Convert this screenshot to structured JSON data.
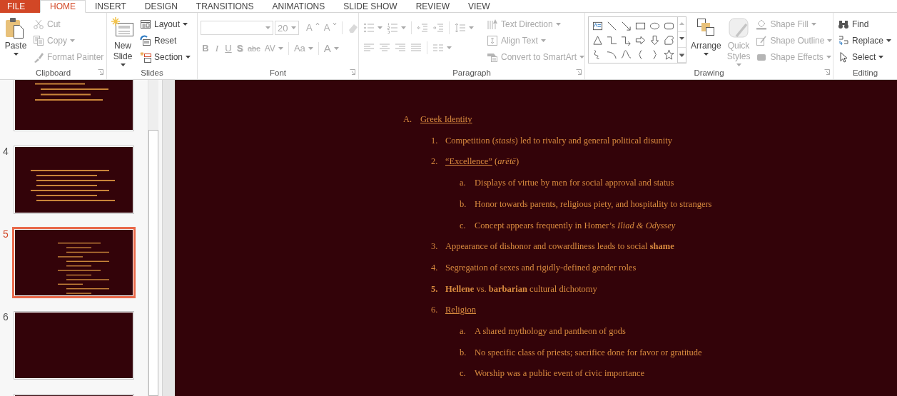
{
  "tabs": [
    {
      "label": "FILE",
      "kind": "file",
      "selected": false
    },
    {
      "label": "HOME",
      "kind": "tab",
      "selected": true
    },
    {
      "label": "INSERT",
      "kind": "tab",
      "selected": false
    },
    {
      "label": "DESIGN",
      "kind": "tab",
      "selected": false
    },
    {
      "label": "TRANSITIONS",
      "kind": "tab",
      "selected": false
    },
    {
      "label": "ANIMATIONS",
      "kind": "tab",
      "selected": false
    },
    {
      "label": "SLIDE SHOW",
      "kind": "tab",
      "selected": false
    },
    {
      "label": "REVIEW",
      "kind": "tab",
      "selected": false
    },
    {
      "label": "VIEW",
      "kind": "tab",
      "selected": false
    }
  ],
  "ribbon": {
    "groups": [
      {
        "kind": "clipboard",
        "label": "Clipboard",
        "launcher": true,
        "large": [
          {
            "label": "Paste",
            "dropdown": true,
            "disabled": false
          }
        ],
        "small": [
          {
            "label": "Cut",
            "dropdown": false,
            "disabled": true
          },
          {
            "label": "Copy",
            "dropdown": true,
            "disabled": true
          },
          {
            "label": "Format Painter",
            "dropdown": false,
            "disabled": true
          }
        ]
      },
      {
        "kind": "slides",
        "label": "Slides",
        "launcher": false,
        "large": [
          {
            "label": "New Slide",
            "dropdown": true,
            "disabled": false
          }
        ],
        "small": [
          {
            "label": "Layout",
            "dropdown": true,
            "disabled": false
          },
          {
            "label": "Reset",
            "dropdown": false,
            "disabled": false
          },
          {
            "label": "Section",
            "dropdown": true,
            "disabled": false
          }
        ]
      },
      {
        "kind": "font",
        "label": "Font",
        "launcher": true,
        "fields": [
          {
            "kind": "font_name",
            "disabled": true
          },
          {
            "kind": "font_size",
            "value": "20",
            "disabled": true
          }
        ],
        "top_buttons": [
          {
            "label": "A",
            "kind": "grow",
            "dropdown": false,
            "disabled": true
          },
          {
            "label": "A",
            "kind": "shrink",
            "dropdown": false,
            "disabled": true
          },
          {
            "kind": "clear",
            "dropdown": false,
            "disabled": true
          }
        ],
        "bottom_buttons": [
          {
            "label": "B",
            "kind": "bold",
            "dropdown": false,
            "disabled": true
          },
          {
            "label": "I",
            "kind": "italic",
            "dropdown": false,
            "disabled": true
          },
          {
            "label": "U",
            "kind": "underline",
            "dropdown": false,
            "disabled": true
          },
          {
            "label": "S",
            "kind": "shadow",
            "dropdown": false,
            "disabled": true
          },
          {
            "label": "abc",
            "kind": "strike",
            "dropdown": false,
            "disabled": true
          },
          {
            "label": "AV",
            "kind": "spacing",
            "dropdown": true,
            "disabled": true
          },
          {
            "label": "Aa",
            "kind": "case",
            "dropdown": true,
            "disabled": true
          },
          {
            "label": "A",
            "kind": "color",
            "dropdown": true,
            "disabled": true
          }
        ]
      },
      {
        "kind": "paragraph",
        "label": "Paragraph",
        "launcher": true,
        "top_tools": [
          {
            "kind": "bullets",
            "dropdown": true,
            "disabled": true
          },
          {
            "kind": "numbering",
            "dropdown": true,
            "disabled": true
          },
          {
            "kind": "outdent",
            "dropdown": false,
            "disabled": true
          },
          {
            "kind": "indent",
            "dropdown": false,
            "disabled": true
          },
          {
            "kind": "line_spacing",
            "dropdown": true,
            "disabled": true
          }
        ],
        "bottom_tools": [
          {
            "kind": "align_left",
            "dropdown": false,
            "disabled": true
          },
          {
            "kind": "center",
            "dropdown": false,
            "disabled": true
          },
          {
            "kind": "align_right",
            "dropdown": false,
            "disabled": true
          },
          {
            "kind": "justify",
            "dropdown": false,
            "disabled": true
          },
          {
            "kind": "columns",
            "dropdown": true,
            "disabled": true
          }
        ],
        "small": [
          {
            "label": "Text Direction",
            "dropdown": true,
            "disabled": true
          },
          {
            "label": "Align Text",
            "dropdown": true,
            "disabled": true
          },
          {
            "label": "Convert to SmartArt",
            "dropdown": true,
            "disabled": true
          }
        ]
      },
      {
        "kind": "drawing",
        "label": "Drawing",
        "launcher": true,
        "large": [
          {
            "label": "Arrange",
            "dropdown": true,
            "disabled": false
          },
          {
            "label": "Quick Styles",
            "dropdown": true,
            "disabled": true
          }
        ],
        "small": [
          {
            "label": "Shape Fill",
            "dropdown": true,
            "disabled": true
          },
          {
            "label": "Shape Outline",
            "dropdown": true,
            "disabled": true
          },
          {
            "label": "Shape Effects",
            "dropdown": true,
            "disabled": true
          }
        ]
      },
      {
        "kind": "editing",
        "label": "Editing",
        "launcher": false,
        "small": [
          {
            "label": "Find",
            "dropdown": false,
            "disabled": false
          },
          {
            "label": "Replace",
            "dropdown": true,
            "disabled": false
          },
          {
            "label": "Select",
            "dropdown": true,
            "disabled": false
          }
        ]
      }
    ]
  },
  "slides_panel": {
    "thumbnails": [
      {
        "kind": "text",
        "selected": false
      },
      {
        "number": "4",
        "kind": "text",
        "selected": false
      },
      {
        "number": "5",
        "kind": "text",
        "selected": true
      },
      {
        "number": "6",
        "kind": "blank",
        "selected": false
      },
      {
        "kind": "blank",
        "selected": false
      }
    ]
  },
  "slide": {
    "outline": [
      {
        "marker": "A.",
        "underlined": "Greek Identity",
        "children": [
          {
            "marker": "1.",
            "text": "Competition (*stasis*) led to rivalry and general political disunity",
            "bold_marker": false
          },
          {
            "marker": "2.",
            "underlined": "“Excellence”",
            "text": " (*arētē*)",
            "bold_marker": false,
            "children": [
              {
                "marker": "a.",
                "text": "Displays of virtue by men for social approval and status"
              },
              {
                "marker": "b.",
                "text": "Honor towards parents, religious piety, and hospitality to strangers"
              },
              {
                "marker": "c.",
                "text": "Concept appears frequently in Homer’s *Iliad & Odyssey*"
              }
            ]
          },
          {
            "marker": "3.",
            "text": "Appearance of dishonor and cowardliness leads to social **shame**",
            "bold_marker": false
          },
          {
            "marker": "4.",
            "text": "Segregation of sexes and rigidly-defined gender roles",
            "bold_marker": false
          },
          {
            "marker": "5.",
            "text": "**Hellene** vs. **barbarian** cultural dichotomy",
            "bold_marker": true
          },
          {
            "marker": "6.",
            "underlined": "Religion",
            "bold_marker": false,
            "children": [
              {
                "marker": "a.",
                "text": "A shared mythology and pantheon of gods"
              },
              {
                "marker": "b.",
                "text": "No specific class of priests; sacrifice done for favor or gratitude"
              },
              {
                "marker": "c.",
                "text": "Worship was a public event of civic importance"
              }
            ]
          }
        ]
      }
    ]
  }
}
